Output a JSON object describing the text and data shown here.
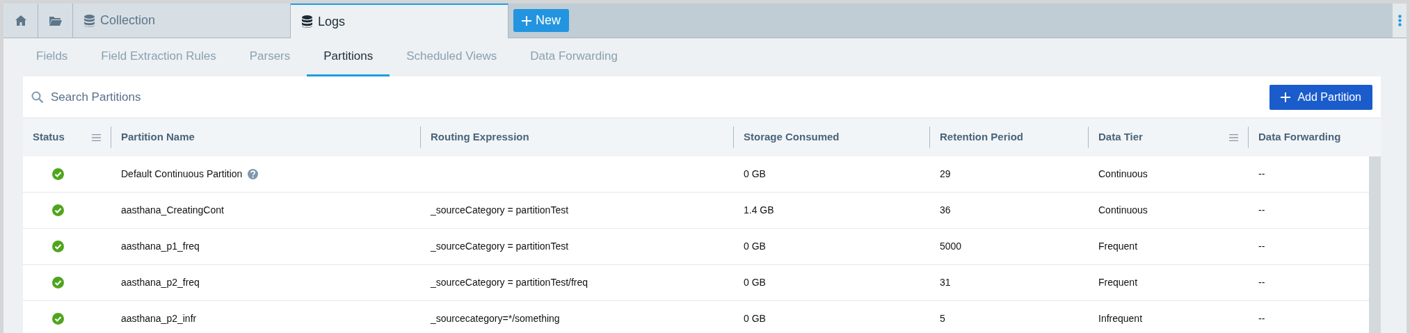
{
  "top_tabs": [
    {
      "kind": "home",
      "selected": false
    },
    {
      "kind": "folder",
      "selected": false
    },
    {
      "kind": "database",
      "label": "Collection",
      "selected": false
    },
    {
      "kind": "database",
      "label": "Logs",
      "selected": true
    }
  ],
  "new_button": "New",
  "sub_tabs": [
    {
      "label": "Fields",
      "selected": false
    },
    {
      "label": "Field Extraction Rules",
      "selected": false
    },
    {
      "label": "Parsers",
      "selected": false
    },
    {
      "label": "Partitions",
      "selected": true
    },
    {
      "label": "Scheduled Views",
      "selected": false
    },
    {
      "label": "Data Forwarding",
      "selected": false
    }
  ],
  "search": {
    "placeholder": "Search Partitions"
  },
  "add_button": "Add Partition",
  "table": {
    "columns": [
      {
        "label": "Status",
        "menu": true
      },
      {
        "label": "Partition Name",
        "menu": false
      },
      {
        "label": "Routing Expression",
        "menu": false
      },
      {
        "label": "Storage Consumed",
        "menu": false
      },
      {
        "label": "Retention Period",
        "menu": false
      },
      {
        "label": "Data Tier",
        "menu": true
      },
      {
        "label": "Data Forwarding",
        "menu": false
      }
    ],
    "rows": [
      {
        "active": true,
        "name": "Default Continuous Partition",
        "help": true,
        "routing": "",
        "storage": "0 GB",
        "retention": "29",
        "tier": "Continuous",
        "forwarding": "--"
      },
      {
        "active": true,
        "name": "aasthana_CreatingCont",
        "help": false,
        "routing": "_sourceCategory = partitionTest",
        "storage": "1.4 GB",
        "retention": "36",
        "tier": "Continuous",
        "forwarding": "--"
      },
      {
        "active": true,
        "name": "aasthana_p1_freq",
        "help": false,
        "routing": "_sourceCategory = partitionTest",
        "storage": "0 GB",
        "retention": "5000",
        "tier": "Frequent",
        "forwarding": "--"
      },
      {
        "active": true,
        "name": "aasthana_p2_freq",
        "help": false,
        "routing": "_sourceCategory = partitionTest/freq",
        "storage": "0 GB",
        "retention": "31",
        "tier": "Frequent",
        "forwarding": "--"
      },
      {
        "active": true,
        "name": "aasthana_p2_infr",
        "help": false,
        "routing": "_sourcecategory=*/something",
        "storage": "0 GB",
        "retention": "5",
        "tier": "Infrequent",
        "forwarding": "--"
      }
    ]
  }
}
